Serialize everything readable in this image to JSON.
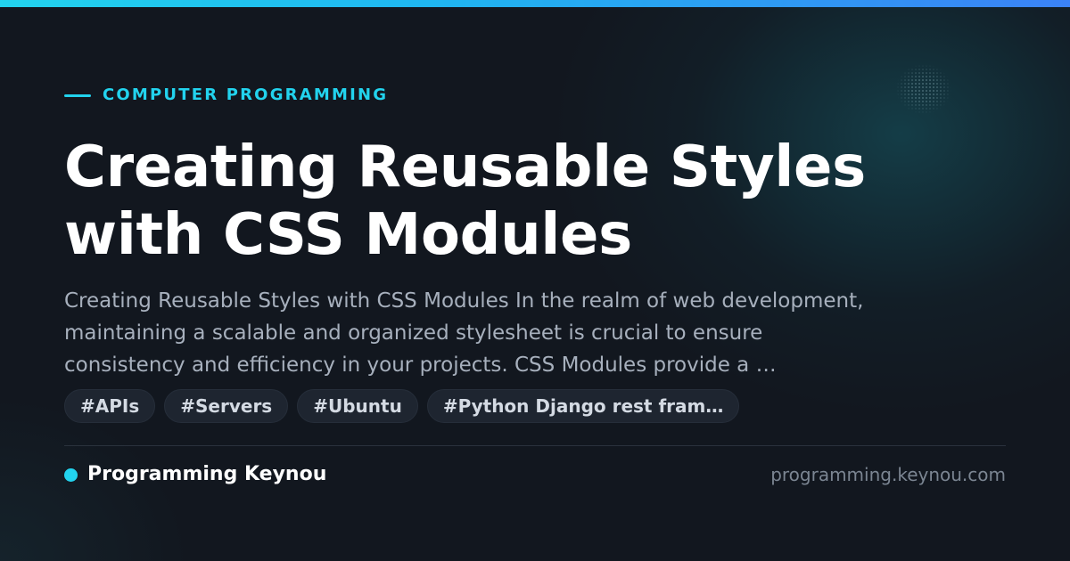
{
  "theme": {
    "accent": "#22d3ee",
    "accent_end": "#3b82f6",
    "background": "#12171f",
    "title_color": "#ffffff",
    "excerpt_color": "#a7b0bd",
    "tag_background": "#1e2530"
  },
  "category": {
    "label": "COMPUTER PROGRAMMING"
  },
  "article": {
    "title_line_1": "Creating Reusable Styles",
    "title_line_2": "with CSS Modules",
    "excerpt_line_1": "Creating Reusable Styles with CSS Modules In the realm of web development,",
    "excerpt_line_2": "maintaining a scalable and organized stylesheet is crucial to ensure",
    "excerpt_line_3": "consistency and efficiency in your projects. CSS Modules provide a …"
  },
  "tags": [
    {
      "label": "#APIs"
    },
    {
      "label": "#Servers"
    },
    {
      "label": "#Ubuntu"
    },
    {
      "label": "#Python Django rest fram…"
    }
  ],
  "footer": {
    "brand_name": "Programming Keynou",
    "domain": "programming.keynou.com"
  }
}
